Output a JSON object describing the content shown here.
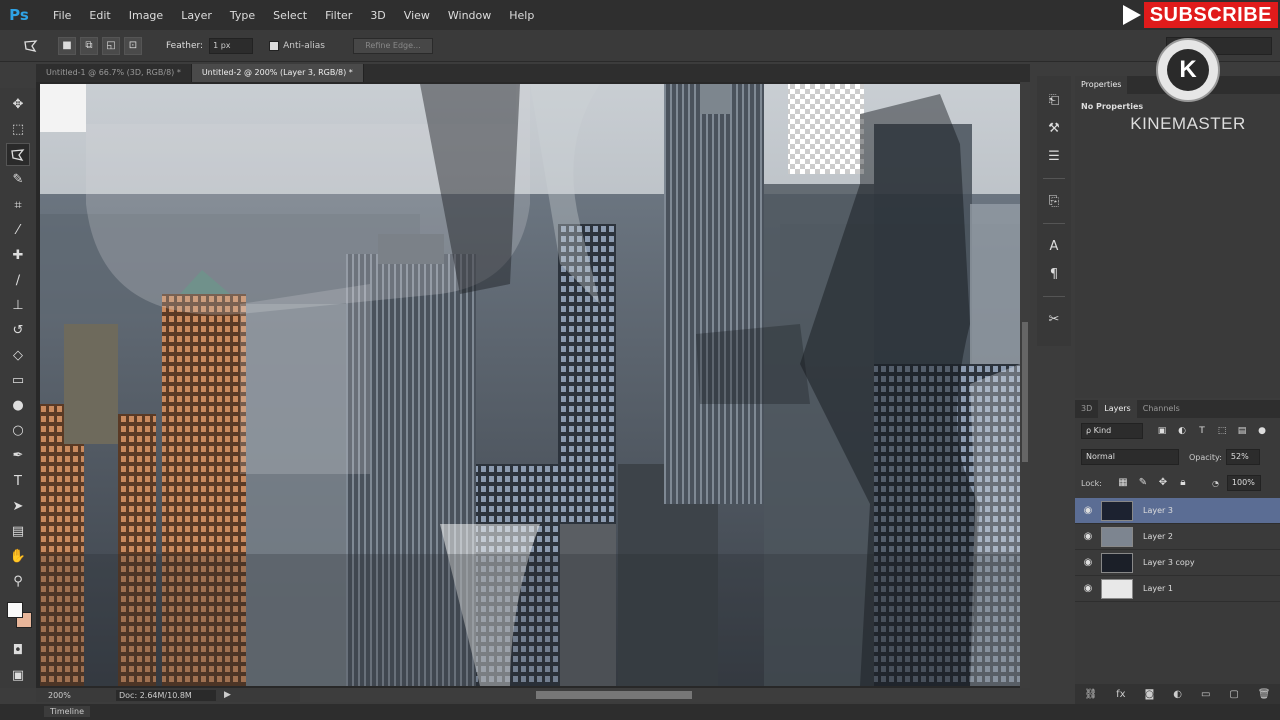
{
  "app": {
    "logo": "Ps",
    "menu": [
      "File",
      "Edit",
      "Image",
      "Layer",
      "Type",
      "Select",
      "Filter",
      "3D",
      "View",
      "Window",
      "Help"
    ]
  },
  "overlay": {
    "subscribe": "SUBSCRIBE",
    "kinemaster_letter": "K",
    "kinemaster_text": "KINEMASTER"
  },
  "options": {
    "feather_label": "Feather:",
    "feather_value": "1 px",
    "antialias_label": "Anti-alias",
    "refine_edge": "Refine Edge..."
  },
  "tabs": [
    {
      "label": "Untitled-1 @ 66.7% (3D, RGB/8) *",
      "active": false
    },
    {
      "label": "Untitled-2 @ 200% (Layer 3, RGB/8) *",
      "active": true
    }
  ],
  "status": {
    "zoom": "200%",
    "doc": "Doc: 2.64M/10.8M"
  },
  "timeline": "Timeline",
  "properties": {
    "tab": "Properties",
    "text": "No Properties"
  },
  "layers_panel": {
    "tabs": [
      "3D",
      "Layers",
      "Channels"
    ],
    "kind": "ρ Kind",
    "blend_mode": "Normal",
    "opacity_label": "Opacity:",
    "opacity_value": "52%",
    "lock_label": "Lock:",
    "fill_value": "100%",
    "layers": [
      {
        "name": "Layer 3",
        "selected": true,
        "thumb": "#1c2230"
      },
      {
        "name": "Layer 2",
        "selected": false,
        "thumb": "#7d8590"
      },
      {
        "name": "Layer 3 copy",
        "selected": false,
        "thumb": "#1b1f28"
      },
      {
        "name": "Layer 1",
        "selected": false,
        "thumb": "#e8e8e8"
      }
    ]
  },
  "colors": {
    "accent": "#5b6d94",
    "subscribe_red": "#e01b1b",
    "ps_blue": "#2fa3e6"
  }
}
